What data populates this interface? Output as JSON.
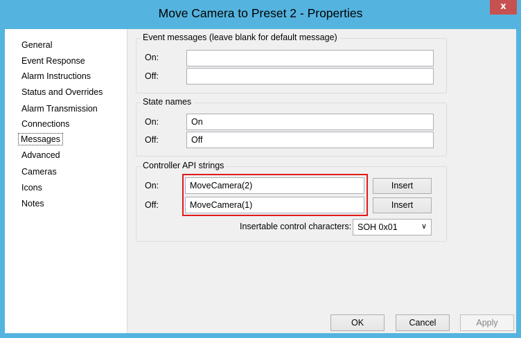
{
  "window": {
    "title": "Move Camera to Preset 2 - Properties",
    "close_glyph": "x"
  },
  "nav": {
    "items": [
      {
        "label": "General"
      },
      {
        "label": "Event Response"
      },
      {
        "label": "Alarm Instructions"
      },
      {
        "label": "Status and Overrides"
      },
      {
        "label": "Alarm Transmission"
      },
      {
        "label": "Connections"
      },
      {
        "label": "Messages",
        "selected": true
      },
      {
        "label": "Advanced"
      },
      {
        "label": "Cameras"
      },
      {
        "label": "Icons"
      },
      {
        "label": "Notes"
      }
    ]
  },
  "event_messages": {
    "title": "Event messages (leave blank for default message)",
    "on_label": "On:",
    "on_value": "",
    "off_label": "Off:",
    "off_value": ""
  },
  "state_names": {
    "title": "State names",
    "on_label": "On:",
    "on_value": "On",
    "off_label": "Off:",
    "off_value": "Off"
  },
  "controller_api": {
    "title": "Controller API strings",
    "on_label": "On:",
    "on_value": "MoveCamera(2)",
    "off_label": "Off:",
    "off_value": "MoveCamera(1)",
    "insert_label": "Insert",
    "control_chars_label": "Insertable control characters:",
    "control_chars_value": "SOH 0x01"
  },
  "footer": {
    "ok": "OK",
    "cancel": "Cancel",
    "apply": "Apply"
  },
  "colors": {
    "titlebar": "#54b4df",
    "close": "#c75050",
    "highlight": "#e21b1b"
  }
}
